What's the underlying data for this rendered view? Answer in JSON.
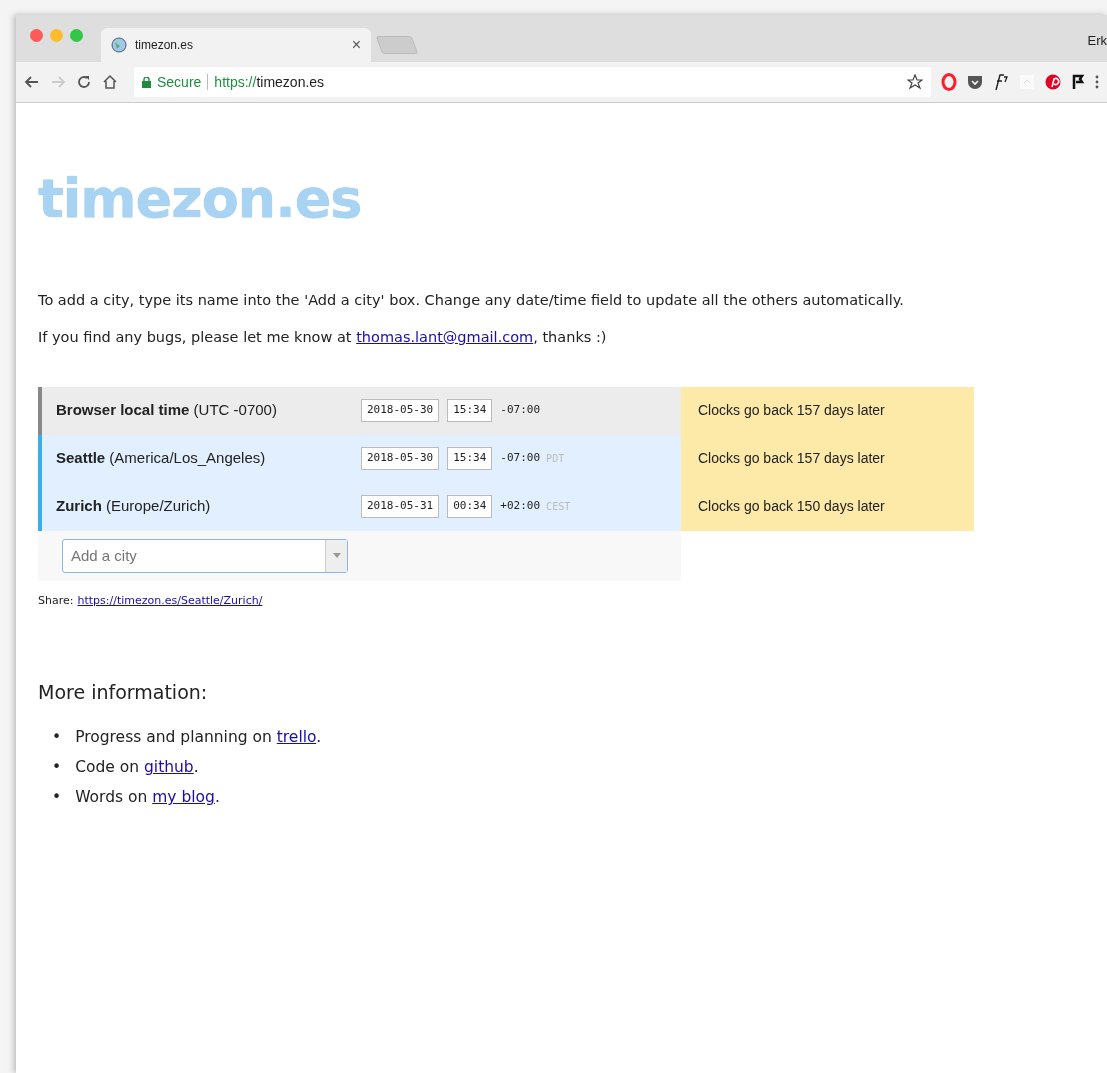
{
  "browser": {
    "tab": {
      "title": "timezon.es",
      "close": "×"
    },
    "profile": "Erk",
    "address": {
      "secure_label": "Secure",
      "scheme": "https://",
      "host": "timezon.es"
    }
  },
  "page": {
    "logo": "timezon.es",
    "intro": "To add a city, type its name into the 'Add a city' box. Change any date/time field to update all the others automatically.",
    "contact": {
      "before": "If you find any bugs, please let me know at ",
      "link": "thomas.lant@gmail.com",
      "after": ", thanks :)"
    },
    "rows": [
      {
        "kind": "local",
        "name": "Browser local time",
        "zone": "(UTC -0700)",
        "date": "2018-05-30",
        "time": "15:34",
        "offset": "-07:00",
        "note": "Clocks go back 157 days later"
      },
      {
        "kind": "city",
        "name": "Seattle",
        "zone": "(America/Los_Angeles)",
        "date": "2018-05-30",
        "time": "15:34",
        "offset": "-07:00",
        "abbr": "PDT",
        "note": "Clocks go back 157 days later"
      },
      {
        "kind": "city",
        "name": "Zurich",
        "zone": "(Europe/Zurich)",
        "date": "2018-05-31",
        "time": "00:34",
        "offset": "+02:00",
        "abbr": "CEST",
        "note": "Clocks go back 150 days later"
      }
    ],
    "add_city": {
      "placeholder": "Add a city"
    },
    "share": {
      "label": "Share:",
      "link": "https://timezon.es/Seattle/Zurich/"
    },
    "more_heading": "More information:",
    "more_items": [
      {
        "bullet": "•",
        "before": "Progress and planning on ",
        "link": "trello",
        "after": "."
      },
      {
        "bullet": "•",
        "before": "Code on ",
        "link": "github",
        "after": "."
      },
      {
        "bullet": "•",
        "before": "Words on ",
        "link": "my blog",
        "after": "."
      }
    ]
  }
}
